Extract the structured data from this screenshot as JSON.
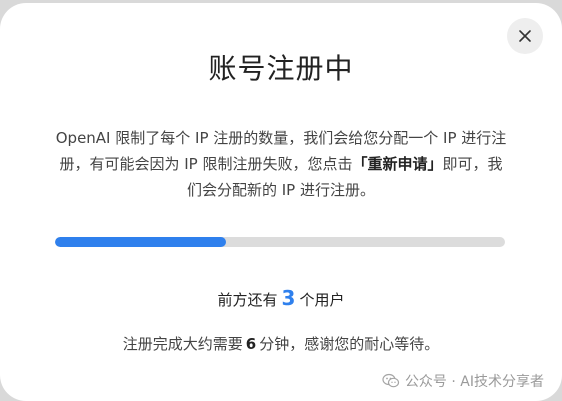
{
  "dialog": {
    "title": "账号注册中",
    "description": {
      "part1": "OpenAI 限制了每个 IP 注册的数量，我们会给您分配一个 IP 进行注册，有可能会因为 IP 限制注册失败，您点击",
      "highlight": "「重新申请」",
      "part2": "即可，我们会分配新的 IP 进行注册。"
    },
    "progress": 0.38,
    "queue": {
      "prefix": "前方还有",
      "count": "3",
      "suffix": "个用户"
    },
    "eta": {
      "prefix": "注册完成大约需要",
      "minutes": "6",
      "suffix": "分钟，感谢您的耐心等待。"
    },
    "close_icon": "close-icon"
  },
  "watermark": {
    "text": "公众号 · AI技术分享者",
    "icon": "wechat-icon"
  },
  "colors": {
    "accent": "#2f80ed",
    "track": "#dcdcdc"
  }
}
